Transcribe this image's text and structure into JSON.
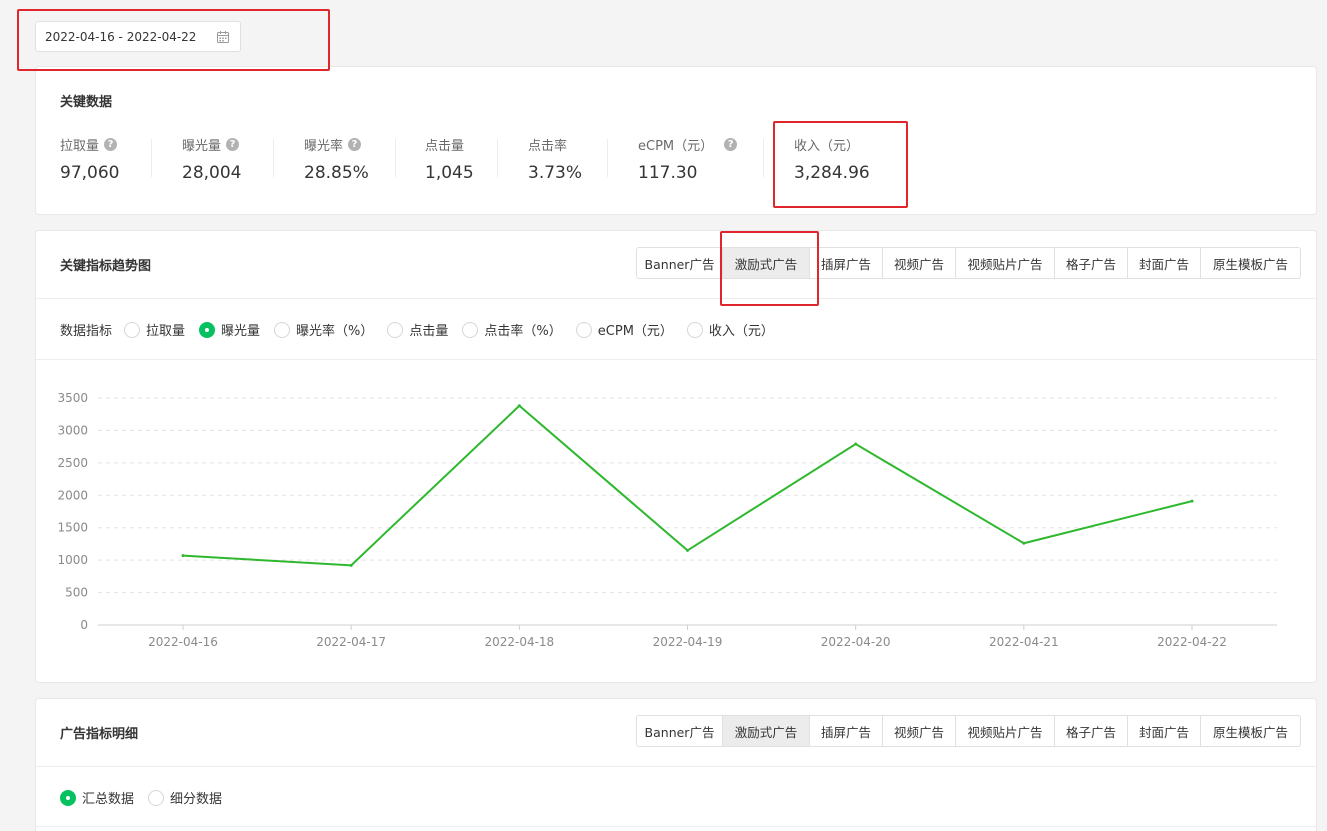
{
  "date_range": {
    "value": "2022-04-16 - 2022-04-22"
  },
  "key_data": {
    "title": "关键数据",
    "metrics": [
      {
        "label": "拉取量",
        "value": "97,060",
        "help": true
      },
      {
        "label": "曝光量",
        "value": "28,004",
        "help": true
      },
      {
        "label": "曝光率",
        "value": "28.85%",
        "help": true
      },
      {
        "label": "点击量",
        "value": "1,045",
        "help": false
      },
      {
        "label": "点击率",
        "value": "3.73%",
        "help": false
      },
      {
        "label": "eCPM（元）",
        "value": "117.30",
        "help": true
      },
      {
        "label": "收入（元）",
        "value": "3,284.96",
        "help": false
      }
    ]
  },
  "trend": {
    "title": "关键指标趋势图",
    "tabs": [
      "Banner广告",
      "激励式广告",
      "插屏广告",
      "视频广告",
      "视频贴片广告",
      "格子广告",
      "封面广告",
      "原生模板广告"
    ],
    "active_tab": "激励式广告",
    "metric_label": "数据指标",
    "metric_options": [
      "拉取量",
      "曝光量",
      "曝光率（%）",
      "点击量",
      "点击率（%）",
      "eCPM（元）",
      "收入（元）"
    ],
    "selected_metric": "曝光量"
  },
  "chart_data": {
    "type": "line",
    "x": [
      "2022-04-16",
      "2022-04-17",
      "2022-04-18",
      "2022-04-19",
      "2022-04-20",
      "2022-04-21",
      "2022-04-22"
    ],
    "series": [
      {
        "values": [
          1070,
          920,
          3380,
          1150,
          2790,
          1260,
          1910
        ]
      }
    ],
    "yticks": [
      0,
      500,
      1000,
      1500,
      2000,
      2500,
      3000,
      3500
    ],
    "ylim": [
      0,
      3500
    ],
    "grid": true,
    "line_color": "#2eb82e"
  },
  "detail": {
    "title": "广告指标明细",
    "tabs": [
      "Banner广告",
      "激励式广告",
      "插屏广告",
      "视频广告",
      "视频贴片广告",
      "格子广告",
      "封面广告",
      "原生模板广告"
    ],
    "active_tab": "激励式广告",
    "view_options": [
      "汇总数据",
      "细分数据"
    ],
    "selected_view": "汇总数据"
  },
  "colors": {
    "accent": "#07c160",
    "annotation": "#e0262b"
  }
}
